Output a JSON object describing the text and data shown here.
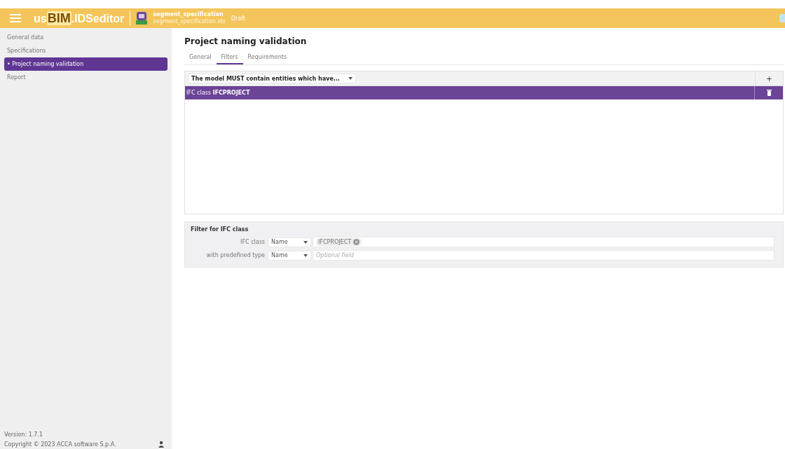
{
  "header": {
    "logo": [
      {
        "text": "us",
        "kind": "plain"
      },
      {
        "text": "BIM",
        "kind": "accent"
      },
      {
        "text": ".IDSeditor",
        "kind": "plain"
      }
    ],
    "file_title": "segment_specification",
    "file_name": "segment_specification.ids",
    "status": "Draft"
  },
  "sidebar": {
    "items": [
      {
        "label": "General data",
        "selected": false
      },
      {
        "label": "Specifications",
        "selected": false
      },
      {
        "label": "• Project naming validation",
        "selected": true
      },
      {
        "label": "Report",
        "selected": false
      }
    ],
    "version": "Version: 1.7.1",
    "copyright": "Copyright © 2023 ACCA software S.p.A."
  },
  "page_title": "Project naming validation",
  "tabs": [
    {
      "label": "General",
      "selected": false
    },
    {
      "label": "Filters",
      "selected": true
    },
    {
      "label": "Requirements",
      "selected": false
    }
  ],
  "grid": {
    "condition": "The model MUST contain entities which have...",
    "add": "+",
    "rows": [
      {
        "text": "IFC class **IFCPROJECT**",
        "selected": true
      }
    ]
  },
  "filter": {
    "title": "Filter for IFC class",
    "fields": [
      {
        "label": "IFC class",
        "mode": "Name",
        "kind": "tags",
        "tags": [
          "IFCPROJECT"
        ]
      },
      {
        "label": "with predefined type",
        "mode": "Name",
        "kind": "text",
        "placeholder": "Optional field"
      }
    ]
  }
}
